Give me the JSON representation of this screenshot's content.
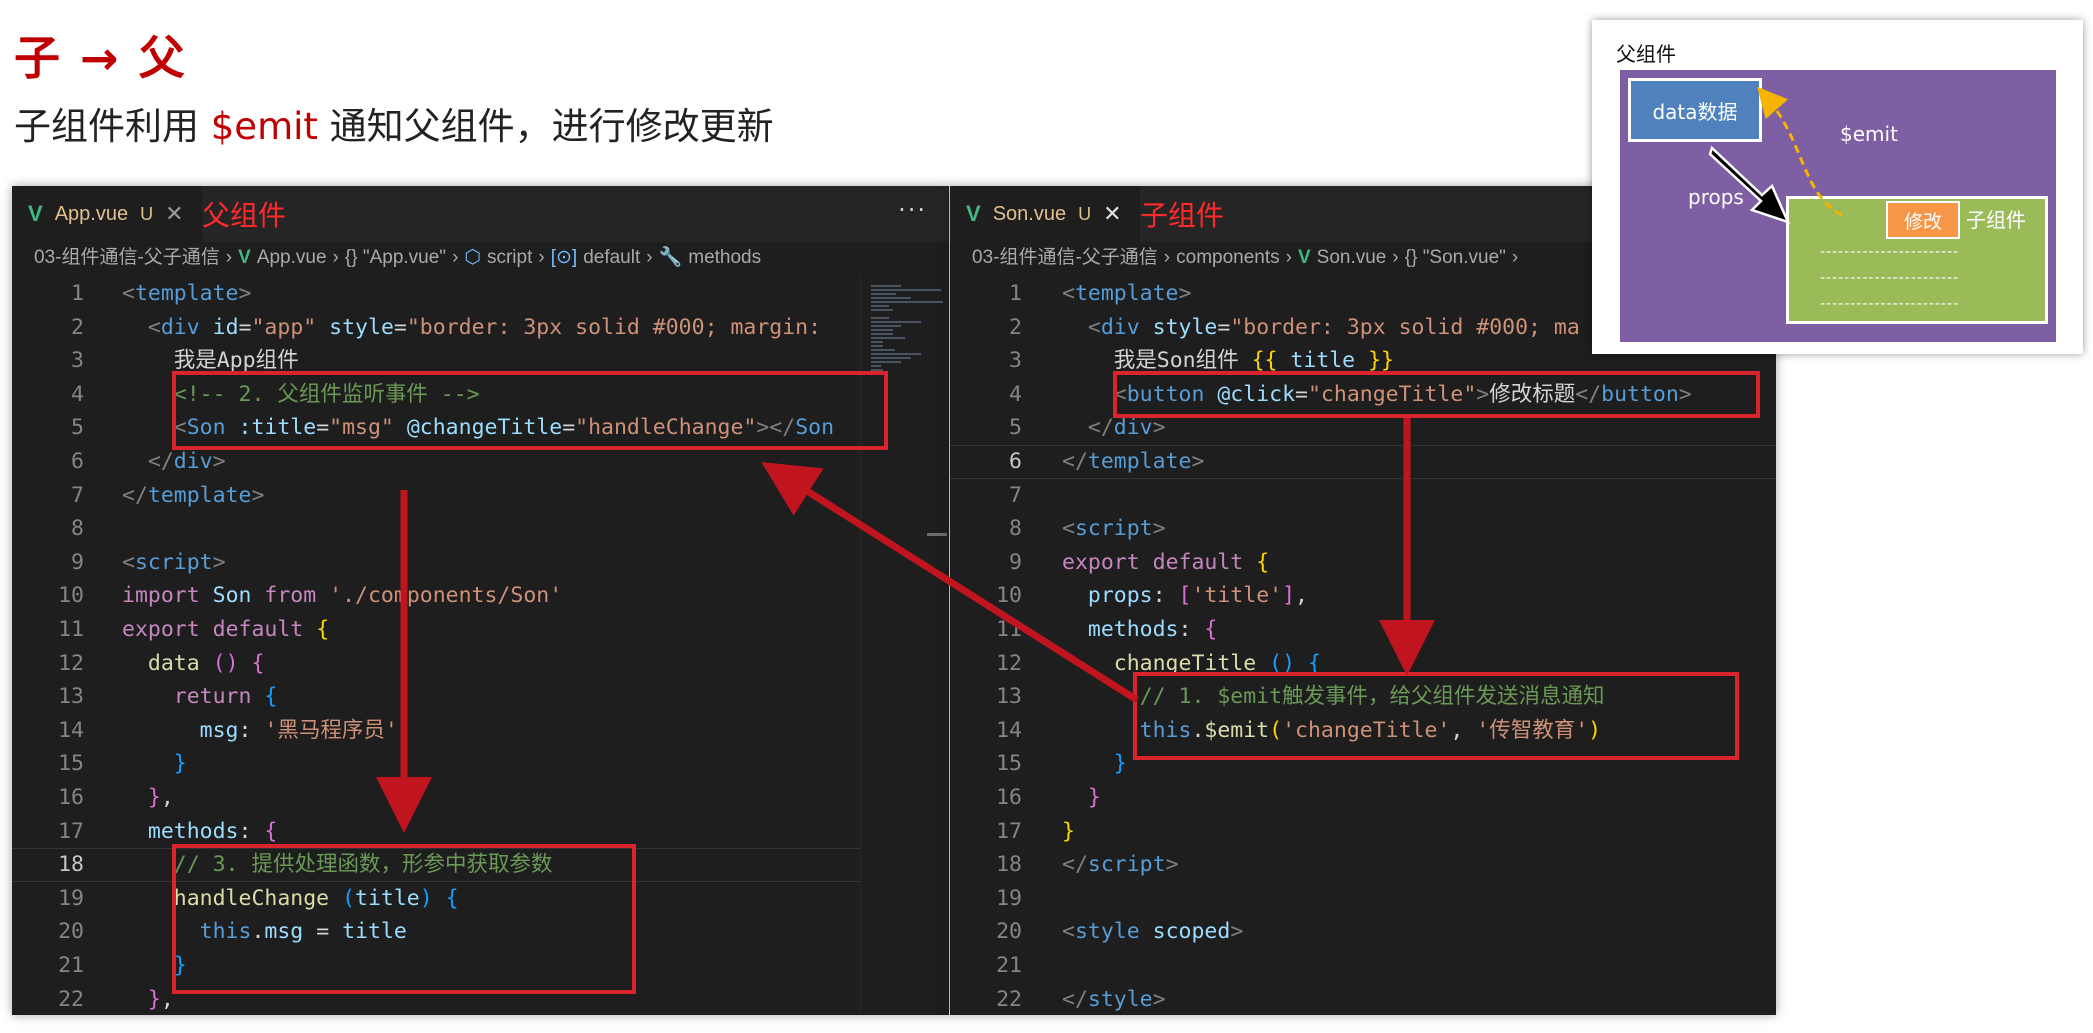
{
  "slide": {
    "title": "子 → 父",
    "subtitle_before": "子组件利用 ",
    "subtitle_em": "$emit",
    "subtitle_after": " 通知父组件，进行修改更新"
  },
  "left_editor": {
    "tab_label": "App.vue",
    "tab_status": "U",
    "tab_annotation": "父组件",
    "more_label": "···",
    "breadcrumb": [
      "03-组件通信-父子通信",
      "App.vue",
      "{} \"App.vue\"",
      "script",
      "default",
      "methods"
    ],
    "current_line": 18,
    "lines": [
      [
        [
          "c-br",
          "<"
        ],
        [
          "c-tag",
          "template"
        ],
        [
          "c-br",
          ">"
        ]
      ],
      [
        [
          "c-txt",
          "  "
        ],
        [
          "c-br",
          "<"
        ],
        [
          "c-tag",
          "div"
        ],
        [
          "c-txt",
          " "
        ],
        [
          "c-attr",
          "id"
        ],
        [
          "c-txt",
          "="
        ],
        [
          "c-str",
          "\"app\""
        ],
        [
          "c-txt",
          " "
        ],
        [
          "c-attr",
          "style"
        ],
        [
          "c-txt",
          "="
        ],
        [
          "c-str",
          "\"border: 3px solid #000; margin:"
        ]
      ],
      [
        [
          "c-txt",
          "    我是App组件"
        ]
      ],
      [
        [
          "c-txt",
          "    "
        ],
        [
          "c-cm",
          "<!-- 2. 父组件监听事件 -->"
        ]
      ],
      [
        [
          "c-txt",
          "    "
        ],
        [
          "c-br",
          "<"
        ],
        [
          "c-tag",
          "Son"
        ],
        [
          "c-txt",
          " "
        ],
        [
          "c-attr",
          ":title"
        ],
        [
          "c-txt",
          "="
        ],
        [
          "c-str",
          "\"msg\""
        ],
        [
          "c-txt",
          " "
        ],
        [
          "c-attr",
          "@changeTitle"
        ],
        [
          "c-txt",
          "="
        ],
        [
          "c-str",
          "\"handleChange\""
        ],
        [
          "c-br",
          "></"
        ],
        [
          "c-tag",
          "Son"
        ]
      ],
      [
        [
          "c-txt",
          "  "
        ],
        [
          "c-br",
          "</"
        ],
        [
          "c-tag",
          "div"
        ],
        [
          "c-br",
          ">"
        ]
      ],
      [
        [
          "c-br",
          "</"
        ],
        [
          "c-tag",
          "template"
        ],
        [
          "c-br",
          ">"
        ]
      ],
      [],
      [
        [
          "c-br",
          "<"
        ],
        [
          "c-tag",
          "script"
        ],
        [
          "c-br",
          ">"
        ]
      ],
      [
        [
          "c-kw",
          "import"
        ],
        [
          "c-txt",
          " "
        ],
        [
          "c-var",
          "Son"
        ],
        [
          "c-txt",
          " "
        ],
        [
          "c-kw",
          "from"
        ],
        [
          "c-txt",
          " "
        ],
        [
          "c-str",
          "'./components/Son'"
        ]
      ],
      [
        [
          "c-kw",
          "export"
        ],
        [
          "c-txt",
          " "
        ],
        [
          "c-kw",
          "default"
        ],
        [
          "c-txt",
          " "
        ],
        [
          "c-b1",
          "{"
        ]
      ],
      [
        [
          "c-txt",
          "  "
        ],
        [
          "c-fn",
          "data"
        ],
        [
          "c-txt",
          " "
        ],
        [
          "c-b2",
          "()"
        ],
        [
          "c-txt",
          " "
        ],
        [
          "c-b2",
          "{"
        ]
      ],
      [
        [
          "c-txt",
          "    "
        ],
        [
          "c-kw",
          "return"
        ],
        [
          "c-txt",
          " "
        ],
        [
          "c-b3",
          "{"
        ]
      ],
      [
        [
          "c-txt",
          "      "
        ],
        [
          "c-var",
          "msg"
        ],
        [
          "c-txt",
          ": "
        ],
        [
          "c-str",
          "'黑马程序员'"
        ]
      ],
      [
        [
          "c-txt",
          "    "
        ],
        [
          "c-b3",
          "}"
        ]
      ],
      [
        [
          "c-txt",
          "  "
        ],
        [
          "c-b2",
          "}"
        ],
        [
          "c-txt",
          ","
        ]
      ],
      [
        [
          "c-txt",
          "  "
        ],
        [
          "c-var",
          "methods"
        ],
        [
          "c-txt",
          ": "
        ],
        [
          "c-b2",
          "{"
        ]
      ],
      [
        [
          "c-txt",
          "    "
        ],
        [
          "c-cm",
          "// 3. 提供处理函数，形参中获取参数"
        ]
      ],
      [
        [
          "c-txt",
          "    "
        ],
        [
          "c-fn",
          "handleChange"
        ],
        [
          "c-txt",
          " "
        ],
        [
          "c-b3",
          "("
        ],
        [
          "c-var",
          "title"
        ],
        [
          "c-b3",
          ")"
        ],
        [
          "c-txt",
          " "
        ],
        [
          "c-b3",
          "{"
        ]
      ],
      [
        [
          "c-txt",
          "      "
        ],
        [
          "c-this",
          "this"
        ],
        [
          "c-txt",
          "."
        ],
        [
          "c-var",
          "msg"
        ],
        [
          "c-txt",
          " = "
        ],
        [
          "c-var",
          "title"
        ]
      ],
      [
        [
          "c-txt",
          "    "
        ],
        [
          "c-b3",
          "}"
        ]
      ],
      [
        [
          "c-txt",
          "  "
        ],
        [
          "c-b2",
          "}"
        ],
        [
          "c-txt",
          ","
        ]
      ]
    ]
  },
  "right_editor": {
    "tab_label": "Son.vue",
    "tab_status": "U",
    "tab_annotation": "子组件",
    "breadcrumb": [
      "03-组件通信-父子通信",
      "components",
      "Son.vue",
      "{} \"Son.vue\""
    ],
    "current_line": 6,
    "lines": [
      [
        [
          "c-br",
          "<"
        ],
        [
          "c-tag",
          "template"
        ],
        [
          "c-br",
          ">"
        ]
      ],
      [
        [
          "c-txt",
          "  "
        ],
        [
          "c-br",
          "<"
        ],
        [
          "c-tag",
          "div"
        ],
        [
          "c-txt",
          " "
        ],
        [
          "c-attr",
          "style"
        ],
        [
          "c-txt",
          "="
        ],
        [
          "c-str",
          "\"border: 3px solid #000; ma"
        ]
      ],
      [
        [
          "c-txt",
          "    我是Son组件 "
        ],
        [
          "c-b1",
          "{{"
        ],
        [
          "c-txt",
          " "
        ],
        [
          "c-var",
          "title"
        ],
        [
          "c-txt",
          " "
        ],
        [
          "c-b1",
          "}}"
        ]
      ],
      [
        [
          "c-txt",
          "    "
        ],
        [
          "c-br",
          "<"
        ],
        [
          "c-tag",
          "button"
        ],
        [
          "c-txt",
          " "
        ],
        [
          "c-attr",
          "@click"
        ],
        [
          "c-txt",
          "="
        ],
        [
          "c-str",
          "\"changeTitle\""
        ],
        [
          "c-br",
          ">"
        ],
        [
          "c-txt",
          "修改标题"
        ],
        [
          "c-br",
          "</"
        ],
        [
          "c-tag",
          "button"
        ],
        [
          "c-br",
          ">"
        ]
      ],
      [
        [
          "c-txt",
          "  "
        ],
        [
          "c-br",
          "</"
        ],
        [
          "c-tag",
          "div"
        ],
        [
          "c-br",
          ">"
        ]
      ],
      [
        [
          "c-br",
          "</"
        ],
        [
          "c-tag",
          "template"
        ],
        [
          "c-br",
          ">"
        ]
      ],
      [],
      [
        [
          "c-br",
          "<"
        ],
        [
          "c-tag",
          "script"
        ],
        [
          "c-br",
          ">"
        ]
      ],
      [
        [
          "c-kw",
          "export"
        ],
        [
          "c-txt",
          " "
        ],
        [
          "c-kw",
          "default"
        ],
        [
          "c-txt",
          " "
        ],
        [
          "c-b1",
          "{"
        ]
      ],
      [
        [
          "c-txt",
          "  "
        ],
        [
          "c-var",
          "props"
        ],
        [
          "c-txt",
          ": "
        ],
        [
          "c-b2",
          "["
        ],
        [
          "c-str",
          "'title'"
        ],
        [
          "c-b2",
          "]"
        ],
        [
          "c-txt",
          ","
        ]
      ],
      [
        [
          "c-txt",
          "  "
        ],
        [
          "c-var",
          "methods"
        ],
        [
          "c-txt",
          ": "
        ],
        [
          "c-b2",
          "{"
        ]
      ],
      [
        [
          "c-txt",
          "    "
        ],
        [
          "c-fn",
          "changeTitle"
        ],
        [
          "c-txt",
          " "
        ],
        [
          "c-b3",
          "()"
        ],
        [
          "c-txt",
          " "
        ],
        [
          "c-b3",
          "{"
        ]
      ],
      [
        [
          "c-txt",
          "      "
        ],
        [
          "c-cm",
          "// 1. $emit触发事件，给父组件发送消息通知"
        ]
      ],
      [
        [
          "c-txt",
          "      "
        ],
        [
          "c-this",
          "this"
        ],
        [
          "c-txt",
          "."
        ],
        [
          "c-fn",
          "$emit"
        ],
        [
          "c-b1",
          "("
        ],
        [
          "c-str",
          "'changeTitle'"
        ],
        [
          "c-txt",
          ", "
        ],
        [
          "c-str",
          "'传智教育'"
        ],
        [
          "c-b1",
          ")"
        ]
      ],
      [
        [
          "c-txt",
          "    "
        ],
        [
          "c-b3",
          "}"
        ]
      ],
      [
        [
          "c-txt",
          "  "
        ],
        [
          "c-b2",
          "}"
        ]
      ],
      [
        [
          "c-b1",
          "}"
        ]
      ],
      [
        [
          "c-br",
          "</"
        ],
        [
          "c-tag",
          "script"
        ],
        [
          "c-br",
          ">"
        ]
      ],
      [],
      [
        [
          "c-br",
          "<"
        ],
        [
          "c-tag",
          "style"
        ],
        [
          "c-txt",
          " "
        ],
        [
          "c-attr",
          "scoped"
        ],
        [
          "c-br",
          ">"
        ]
      ],
      [],
      [
        [
          "c-br",
          "</"
        ],
        [
          "c-tag",
          "style"
        ],
        [
          "c-br",
          ">"
        ]
      ]
    ]
  },
  "diagram": {
    "title": "父组件",
    "data_box": "data数据",
    "emit_label": "$emit",
    "props_label": "props",
    "modify_button": "修改",
    "child_label": "子组件",
    "dash_row": "-----------------------"
  },
  "colors": {
    "annotation_red": "#c00000",
    "highlight_box": "#d9232d",
    "arrow_red": "#c0151f",
    "parent_purple": "#7e5fa3",
    "child_green": "#9bbb59",
    "data_blue": "#4f81bd",
    "modify_orange": "#f79646",
    "emit_arrow_yellow": "#f5b400"
  },
  "icons": [
    "vue-logo-icon",
    "close-icon",
    "more-icon",
    "braces-icon",
    "script-cube-icon",
    "default-export-icon",
    "wrench-icon",
    "chevron-right-icon"
  ]
}
